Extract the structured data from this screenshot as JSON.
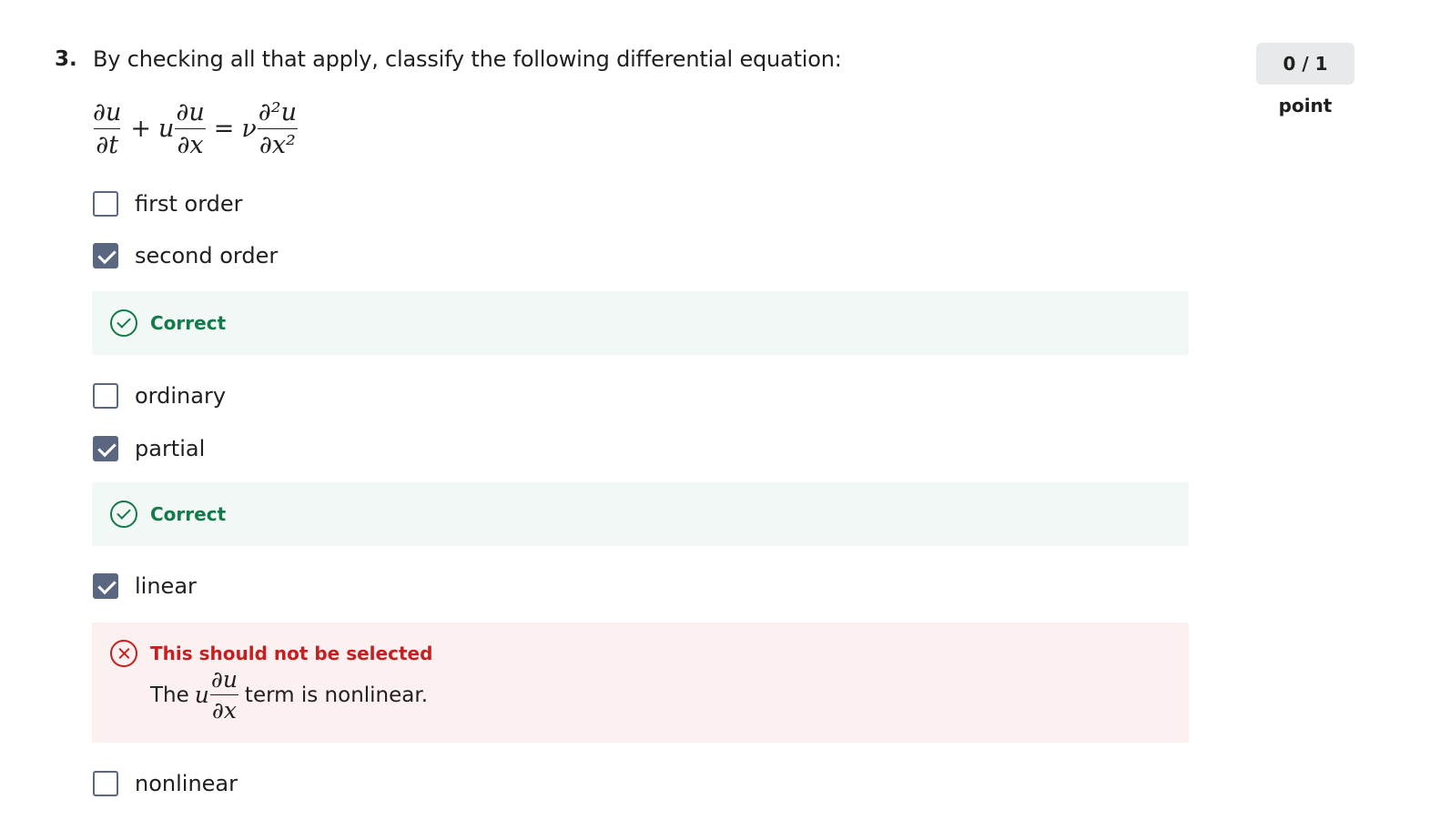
{
  "question": {
    "number": "3.",
    "text": "By checking all that apply, classify the following differential equation:",
    "points": "0 / 1 point"
  },
  "equation": {
    "du": "∂u",
    "dt": "∂t",
    "plus": "+",
    "u": "u",
    "dx": "∂x",
    "equals": "=",
    "nu": "ν",
    "d2u": "∂²u",
    "dx2": "∂x²"
  },
  "options": [
    {
      "label": "first order",
      "checked": false
    },
    {
      "label": "second order",
      "checked": true
    },
    {
      "label": "ordinary",
      "checked": false
    },
    {
      "label": "partial",
      "checked": true
    },
    {
      "label": "linear",
      "checked": true
    },
    {
      "label": "nonlinear",
      "checked": false
    }
  ],
  "feedback": {
    "second_order": {
      "status": "Correct"
    },
    "partial": {
      "status": "Correct"
    },
    "linear": {
      "status": "This should not be selected",
      "explanation_prefix": "The",
      "explanation_suffix": "term is nonlinear."
    }
  },
  "colors": {
    "correct": "#137a4b",
    "incorrect": "#c5201f",
    "checkbox": "#5b6780",
    "correct_bg": "#f2f8f5",
    "incorrect_bg": "#fdf0f1",
    "points_bg": "#e8e9ea"
  }
}
